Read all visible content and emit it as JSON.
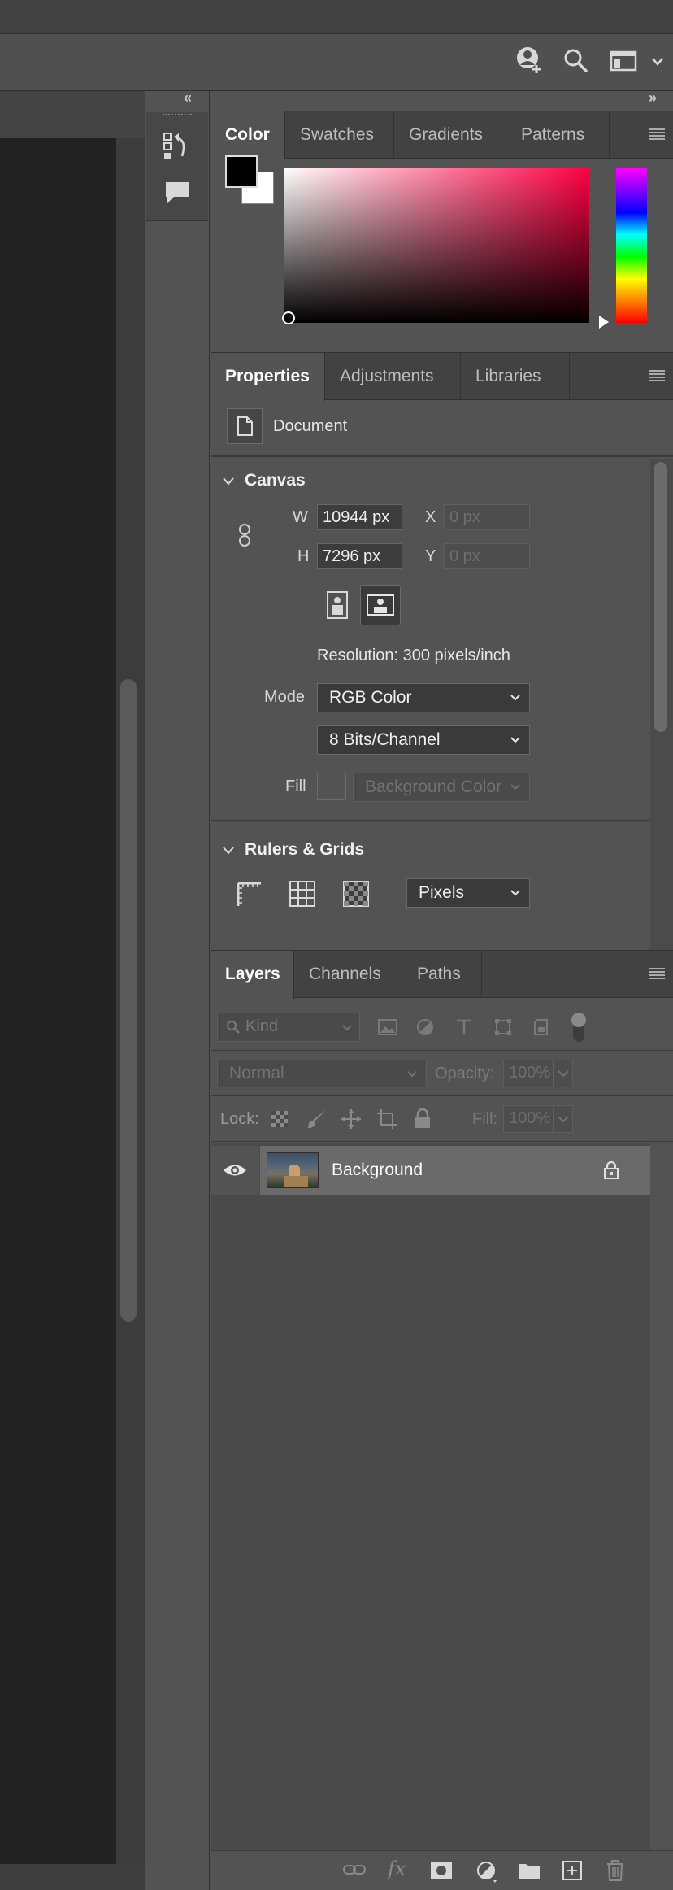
{
  "colors": {
    "foreground": "#000000",
    "background": "#ffffff",
    "hue": "#ff0044"
  },
  "color_panel": {
    "tabs": [
      {
        "label": "Color"
      },
      {
        "label": "Swatches"
      },
      {
        "label": "Gradients"
      },
      {
        "label": "Patterns"
      }
    ]
  },
  "properties_panel": {
    "tabs": [
      {
        "label": "Properties"
      },
      {
        "label": "Adjustments"
      },
      {
        "label": "Libraries"
      }
    ],
    "document_label": "Document",
    "canvas": {
      "title": "Canvas",
      "w_label": "W",
      "w_value": "10944 px",
      "h_label": "H",
      "h_value": "7296 px",
      "x_label": "X",
      "x_placeholder": "0 px",
      "y_label": "Y",
      "y_placeholder": "0 px",
      "resolution": "Resolution: 300 pixels/inch",
      "mode_label": "Mode",
      "mode_value": "RGB Color",
      "bits_value": "8 Bits/Channel",
      "fill_label": "Fill",
      "fill_value": "Background Color"
    },
    "rulers": {
      "title": "Rulers & Grids",
      "units_value": "Pixels"
    }
  },
  "layers_panel": {
    "tabs": [
      {
        "label": "Layers"
      },
      {
        "label": "Channels"
      },
      {
        "label": "Paths"
      }
    ],
    "filter_placeholder": "Kind",
    "blend_mode": "Normal",
    "opacity_label": "Opacity:",
    "opacity_value": "100%",
    "lock_label": "Lock:",
    "fill_label": "Fill:",
    "fill_value": "100%",
    "layers": [
      {
        "name": "Background",
        "visible": true,
        "locked": true
      }
    ]
  },
  "icons": {
    "top": [
      "share-user-icon",
      "search-icon",
      "workspace-icon",
      "chevron-down-icon"
    ],
    "bottom": [
      "link-icon",
      "fx-icon",
      "mask-icon",
      "adjustment-icon",
      "folder-icon",
      "new-layer-icon",
      "trash-icon"
    ]
  }
}
